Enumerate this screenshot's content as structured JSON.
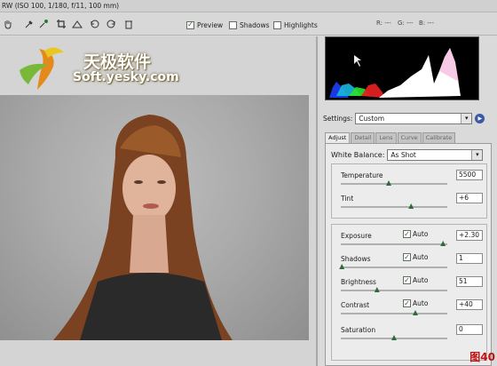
{
  "title": "RW  (ISO 100, 1/180, f/11, 100 mm)",
  "toolbar": {
    "tools": [
      "hand-icon",
      "white-balance-eyedropper-icon",
      "color-sampler-icon",
      "crop-icon",
      "straighten-icon",
      "rotate-left-icon",
      "rotate-right-icon",
      "trash-icon"
    ],
    "preview_label": "Preview",
    "preview_checked": true,
    "shadows_label": "Shadows",
    "shadows_checked": false,
    "highlights_label": "Highlights",
    "highlights_checked": false,
    "r_readout": "R: ---",
    "g_readout": "G: ---",
    "b_readout": "B: ---"
  },
  "watermark": {
    "cn": "天极软件",
    "en": "Soft.yesky.com"
  },
  "settings": {
    "label": "Settings:",
    "value": "Custom"
  },
  "tabs": [
    {
      "label": "Adjust",
      "active": true
    },
    {
      "label": "Detail",
      "active": false
    },
    {
      "label": "Lens",
      "active": false
    },
    {
      "label": "Curve",
      "active": false
    },
    {
      "label": "Calibrate",
      "active": false
    }
  ],
  "white_balance": {
    "label": "White Balance:",
    "value": "As Shot"
  },
  "controls": {
    "temperature": {
      "label": "Temperature",
      "value": "5500",
      "level": 0.45
    },
    "tint": {
      "label": "Tint",
      "value": "+6",
      "level": 0.66
    },
    "exposure": {
      "label": "Exposure",
      "auto_label": "Auto",
      "auto_checked": true,
      "value": "+2.30",
      "level": 0.96
    },
    "shadows": {
      "label": "Shadows",
      "auto_label": "Auto",
      "auto_checked": true,
      "value": "1",
      "level": 0.01
    },
    "brightness": {
      "label": "Brightness",
      "auto_label": "Auto",
      "auto_checked": true,
      "value": "51",
      "level": 0.34
    },
    "contrast": {
      "label": "Contrast",
      "auto_label": "Auto",
      "auto_checked": true,
      "value": "+40",
      "level": 0.7
    },
    "saturation": {
      "label": "Saturation",
      "value": "0",
      "level": 0.5
    }
  },
  "figure_label": "图40"
}
